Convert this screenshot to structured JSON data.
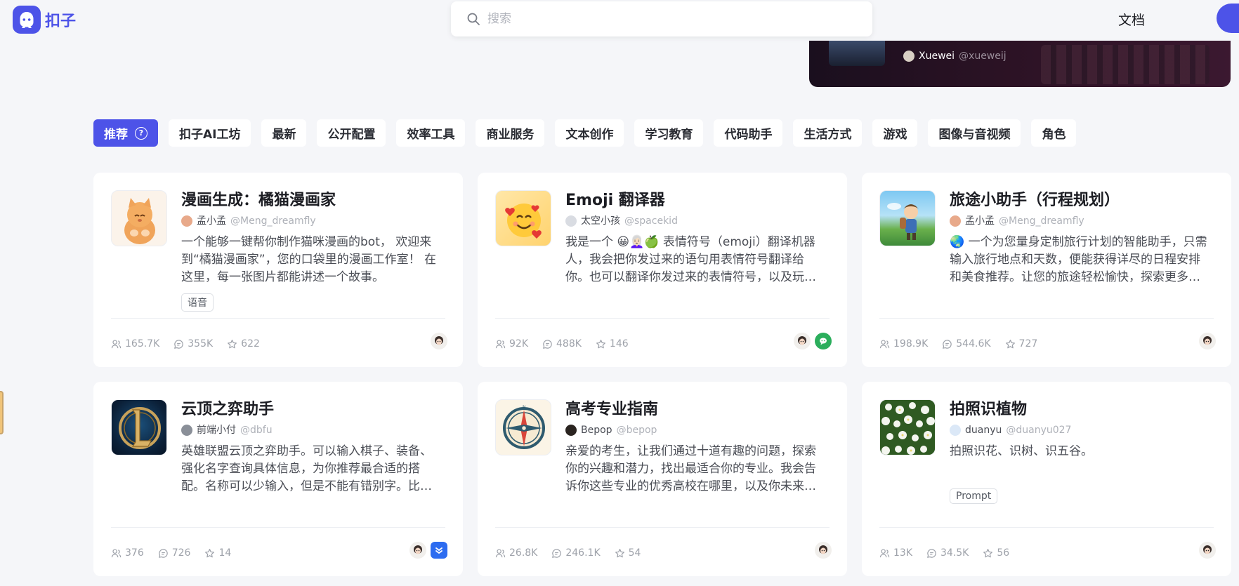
{
  "header": {
    "logo_text": "扣子",
    "search_placeholder": "搜索",
    "docs_label": "文档"
  },
  "banner": {
    "author_name": "Xuewei",
    "author_handle": "@xueweij"
  },
  "tabs": [
    {
      "label": "推荐",
      "active": true
    },
    {
      "label": "扣子AI工坊"
    },
    {
      "label": "最新"
    },
    {
      "label": "公开配置"
    },
    {
      "label": "效率工具"
    },
    {
      "label": "商业服务"
    },
    {
      "label": "文本创作"
    },
    {
      "label": "学习教育"
    },
    {
      "label": "代码助手"
    },
    {
      "label": "生活方式"
    },
    {
      "label": "游戏"
    },
    {
      "label": "图像与音视频"
    },
    {
      "label": "角色"
    }
  ],
  "cards": [
    {
      "title": "漫画生成：橘猫漫画家",
      "author_name": "孟小孟",
      "author_handle": "@Meng_dreamfly",
      "description": "一个能够一键帮你制作猫咪漫画的bot， 欢迎来到“橘猫漫画家”，您的口袋里的漫画工作室！ 在这里，每一张图片都能讲述一个故事。",
      "tag": "语音",
      "users": "165.7K",
      "messages": "355K",
      "stars": "622",
      "avatar_icon": "orange-cat-icon",
      "platforms": [
        "doubao"
      ]
    },
    {
      "title": "Emoji 翻译器",
      "author_name": "太空小孩",
      "author_handle": "@spacekid",
      "description": "我是一个 😀👩🏻‍🦳🍏 表情符号（emoji）翻译机器人，我会把你发过来的语句用表情符号翻译给你。也可以翻译你发过来的表情符号，以及玩表情符号猜谜游戏。",
      "tag": "",
      "users": "92K",
      "messages": "488K",
      "stars": "146",
      "avatar_icon": "smiling-face-hearts-icon",
      "platforms": [
        "doubao",
        "wechat"
      ]
    },
    {
      "title": "旅途小助手（行程规划）",
      "author_name": "孟小孟",
      "author_handle": "@Meng_dreamfly",
      "description": "🌏 一个为您量身定制旅行计划的智能助手，只需输入旅行地点和天数，便能获得详尽的日程安排和美食推荐。让您的旅途轻松愉快，探索更多美好。",
      "tag": "",
      "users": "198.9K",
      "messages": "544.6K",
      "stars": "727",
      "avatar_icon": "traveler-boy-icon",
      "platforms": [
        "doubao"
      ]
    },
    {
      "title": "云顶之弈助手",
      "author_name": "前端小付",
      "author_handle": "@dbfu",
      "description": "英雄联盟云顶之弈助手。可以输入棋子、装备、强化名字查询具体信息，为你推荐最合适的搭配。名称可以少输入，但是不能有错别字。比如：纳尔。",
      "tag": "",
      "users": "376",
      "messages": "726",
      "stars": "14",
      "avatar_icon": "league-logo-icon",
      "platforms": [
        "doubao",
        "feishu"
      ]
    },
    {
      "title": "高考专业指南",
      "author_name": "Bepop",
      "author_handle": "@bepop",
      "description": "亲爱的考生，让我们通过十道有趣的问题，探索你的兴趣和潜力，找出最适合你的专业。我会告诉你这些专业的优秀高校在哪里，以及你未来的发展方向。",
      "tag": "",
      "users": "26.8K",
      "messages": "246.1K",
      "stars": "54",
      "avatar_icon": "compass-icon",
      "platforms": [
        "doubao"
      ]
    },
    {
      "title": "拍照识植物",
      "author_name": "duanyu",
      "author_handle": "@duanyu027",
      "description": "拍照识花、识树、识五谷。",
      "tag": "Prompt",
      "users": "13K",
      "messages": "34.5K",
      "stars": "56",
      "avatar_icon": "white-flowers-icon",
      "platforms": [
        "doubao"
      ]
    }
  ],
  "colors": {
    "accent": "#4d53e8",
    "page_bg": "#f5f6f9",
    "card_bg": "#ffffff"
  }
}
